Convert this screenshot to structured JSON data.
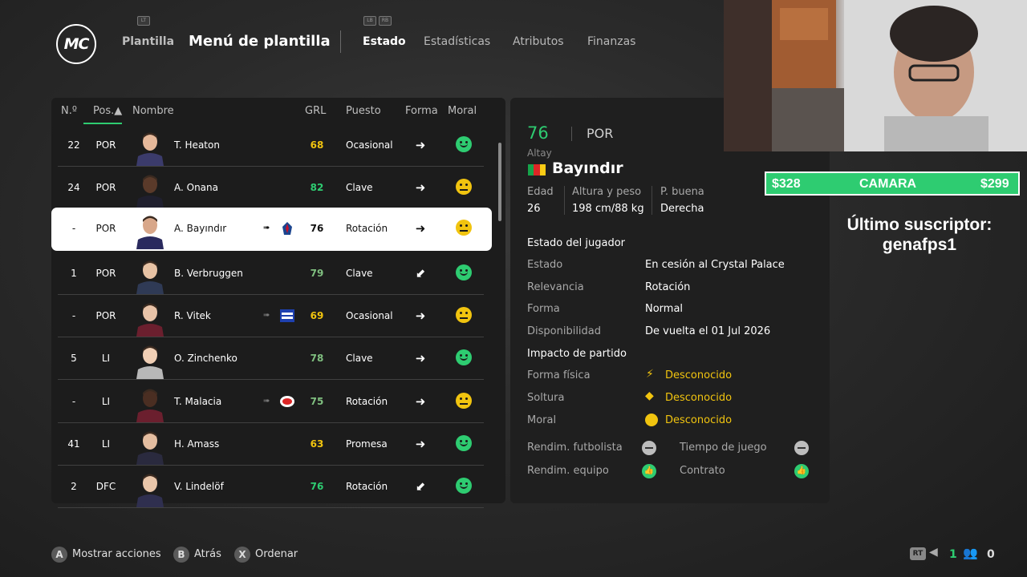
{
  "header": {
    "logo_text": "MC",
    "nav_plantilla": "Plantilla",
    "btn_hint_left": "LT",
    "page_title": "Menú de plantilla",
    "btn_hint_lb": "LB",
    "btn_hint_rb": "RB",
    "tabs": [
      {
        "label": "Estado"
      },
      {
        "label": "Estadísticas"
      },
      {
        "label": "Atributos"
      },
      {
        "label": "Finanzas"
      }
    ]
  },
  "table": {
    "columns": [
      "N.º",
      "Pos.▲",
      "Nombre",
      "GRL",
      "Puesto",
      "Forma",
      "Moral"
    ],
    "rows": [
      {
        "num": "22",
        "pos": "POR",
        "name": "T. Heaton",
        "grl": "68",
        "puesto": "Ocasional",
        "forma": "➜",
        "moral": "happy"
      },
      {
        "num": "24",
        "pos": "POR",
        "name": "A. Onana",
        "grl": "82",
        "puesto": "Clave",
        "forma": "➜",
        "moral": "neutral"
      },
      {
        "num": "-",
        "pos": "POR",
        "name": "A. Bayındır",
        "grl": "76",
        "puesto": "Rotación",
        "forma": "➜",
        "moral": "neutral"
      },
      {
        "num": "1",
        "pos": "POR",
        "name": "B. Verbruggen",
        "grl": "79",
        "puesto": "Clave",
        "forma": "⬋",
        "moral": "happy"
      },
      {
        "num": "-",
        "pos": "POR",
        "name": "R. Vitek",
        "grl": "69",
        "puesto": "Ocasional",
        "forma": "➜",
        "moral": "neutral"
      },
      {
        "num": "5",
        "pos": "LI",
        "name": "O. Zinchenko",
        "grl": "78",
        "puesto": "Clave",
        "forma": "➜",
        "moral": "happy"
      },
      {
        "num": "-",
        "pos": "LI",
        "name": "T. Malacia",
        "grl": "75",
        "puesto": "Rotación",
        "forma": "➜",
        "moral": "neutral"
      },
      {
        "num": "41",
        "pos": "LI",
        "name": "H. Amass",
        "grl": "63",
        "puesto": "Promesa",
        "forma": "➜",
        "moral": "happy"
      },
      {
        "num": "2",
        "pos": "DFC",
        "name": "V. Lindelöf",
        "grl": "76",
        "puesto": "Rotación",
        "forma": "⬋",
        "moral": "happy"
      }
    ],
    "loan_arrow": "➠",
    "colors": {
      "green": "#2ecc71",
      "yellow": "#f1c40f",
      "dim_green": "#7fbf7f",
      "moral_happy": "#2ecc71",
      "moral_neutral": "#f1c40f"
    }
  },
  "detail": {
    "rating": "76",
    "position": "POR",
    "first_name": "Altay",
    "last_name": "Bayındır",
    "age_label": "Edad",
    "age": "26",
    "hw_label": "Altura y peso",
    "hw": "198 cm/88 kg",
    "foot_label": "P. buena",
    "foot": "Derecha",
    "status_title": "Estado del jugador",
    "status_rows": [
      {
        "label": "Estado",
        "value": "En cesión al Crystal Palace"
      },
      {
        "label": "Relevancia",
        "value": "Rotación"
      },
      {
        "label": "Forma",
        "value": "Normal"
      },
      {
        "label": "Disponibilidad",
        "value": "De vuelta el 01 Jul 2026"
      }
    ],
    "impact_title": "Impacto de partido",
    "impact_rows": [
      {
        "label": "Forma física",
        "value": "Desconocido",
        "icon": "lightning-icon"
      },
      {
        "label": "Soltura",
        "value": "Desconocido",
        "icon": "diamond-icon"
      },
      {
        "label": "Moral",
        "value": "Desconocido",
        "icon": "smiley-icon"
      }
    ],
    "perf": {
      "rend_futbolista": "Rendim. futbolista",
      "tiempo_juego": "Tiempo de juego",
      "rend_equipo": "Rendim. equipo",
      "contrato": "Contrato"
    }
  },
  "overlay": {
    "cam_left": "$328",
    "cam_center": "CAMARA",
    "cam_right": "$299",
    "subscriber": "Último suscriptor: genafps1"
  },
  "footer": {
    "actions": [
      {
        "button": "A",
        "label": "Mostrar acciones"
      },
      {
        "button": "B",
        "label": "Atrás"
      },
      {
        "button": "X",
        "label": "Ordenar"
      }
    ],
    "rt": "RT",
    "count_green": "1",
    "count_people": "0"
  }
}
